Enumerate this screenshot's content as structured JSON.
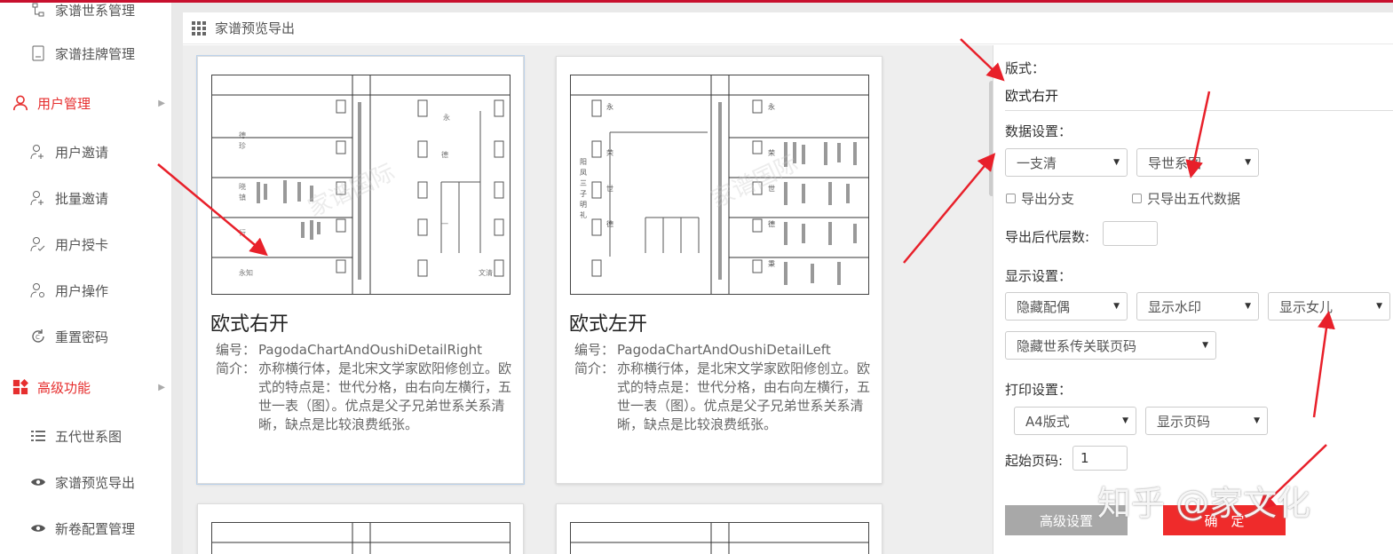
{
  "sidebar": {
    "items": [
      {
        "label": "家谱世系管理",
        "icon": "tree-icon"
      },
      {
        "label": "家谱挂牌管理",
        "icon": "document-icon"
      },
      {
        "label": "用户管理",
        "icon": "user-icon",
        "group": true
      },
      {
        "label": "用户邀请",
        "icon": "user-add-icon"
      },
      {
        "label": "批量邀请",
        "icon": "users-add-icon"
      },
      {
        "label": "用户授卡",
        "icon": "user-check-icon"
      },
      {
        "label": "用户操作",
        "icon": "user-gear-icon"
      },
      {
        "label": "重置密码",
        "icon": "reset-icon"
      },
      {
        "label": "高级功能",
        "icon": "grid-icon",
        "group": true
      },
      {
        "label": "五代世系图",
        "icon": "list-icon"
      },
      {
        "label": "家谱预览导出",
        "icon": "eye-icon"
      },
      {
        "label": "新卷配置管理",
        "icon": "eye-icon"
      }
    ]
  },
  "breadcrumb": {
    "title": "家谱预览导出"
  },
  "cards": [
    {
      "title": "欧式右开",
      "code_label": "编号：",
      "code": "PagodaChartAndOushiDetailRight",
      "desc_label": "简介：",
      "desc": "亦称横行体，是北宋文学家欧阳修创立。欧式的特点是：世代分格，由右向左横行，五世一表（图）。优点是父子兄弟世系关系清晰，缺点是比较浪费纸张。",
      "selected": true
    },
    {
      "title": "欧式左开",
      "code_label": "编号：",
      "code": "PagodaChartAndOushiDetailLeft",
      "desc_label": "简介：",
      "desc": "亦称横行体，是北宋文学家欧阳修创立。欧式的特点是：世代分格，由右向左横行，五世一表（图）。优点是父子兄弟世系关系清晰，缺点是比较浪费纸张。",
      "selected": false
    }
  ],
  "watermark": "家谱国际",
  "form": {
    "layout_label": "版式：",
    "layout_value": "欧式右开",
    "data_label": "数据设置：",
    "data_select1": "一支清",
    "data_select2": "导世系图",
    "chk_branch": "导出分支",
    "chk_five": "只导出五代数据",
    "gen_label": "导出后代层数:",
    "gen_value": "",
    "display_label": "显示设置：",
    "display_select1": "隐藏配偶",
    "display_select2": "显示水印",
    "display_select3": "显示女儿",
    "display_select4": "隐藏世系传关联页码",
    "print_label": "打印设置：",
    "print_select1": "A4版式",
    "print_select2": "显示页码",
    "start_label": "起始页码:",
    "start_value": "1",
    "adv_button": "高级设置",
    "ok_button": "确　定"
  },
  "zhihu_watermark": "知乎 @家文化",
  "colors": {
    "accent": "#e62e2e",
    "ok": "#ef2b2b",
    "adv": "#a8a8a8"
  }
}
